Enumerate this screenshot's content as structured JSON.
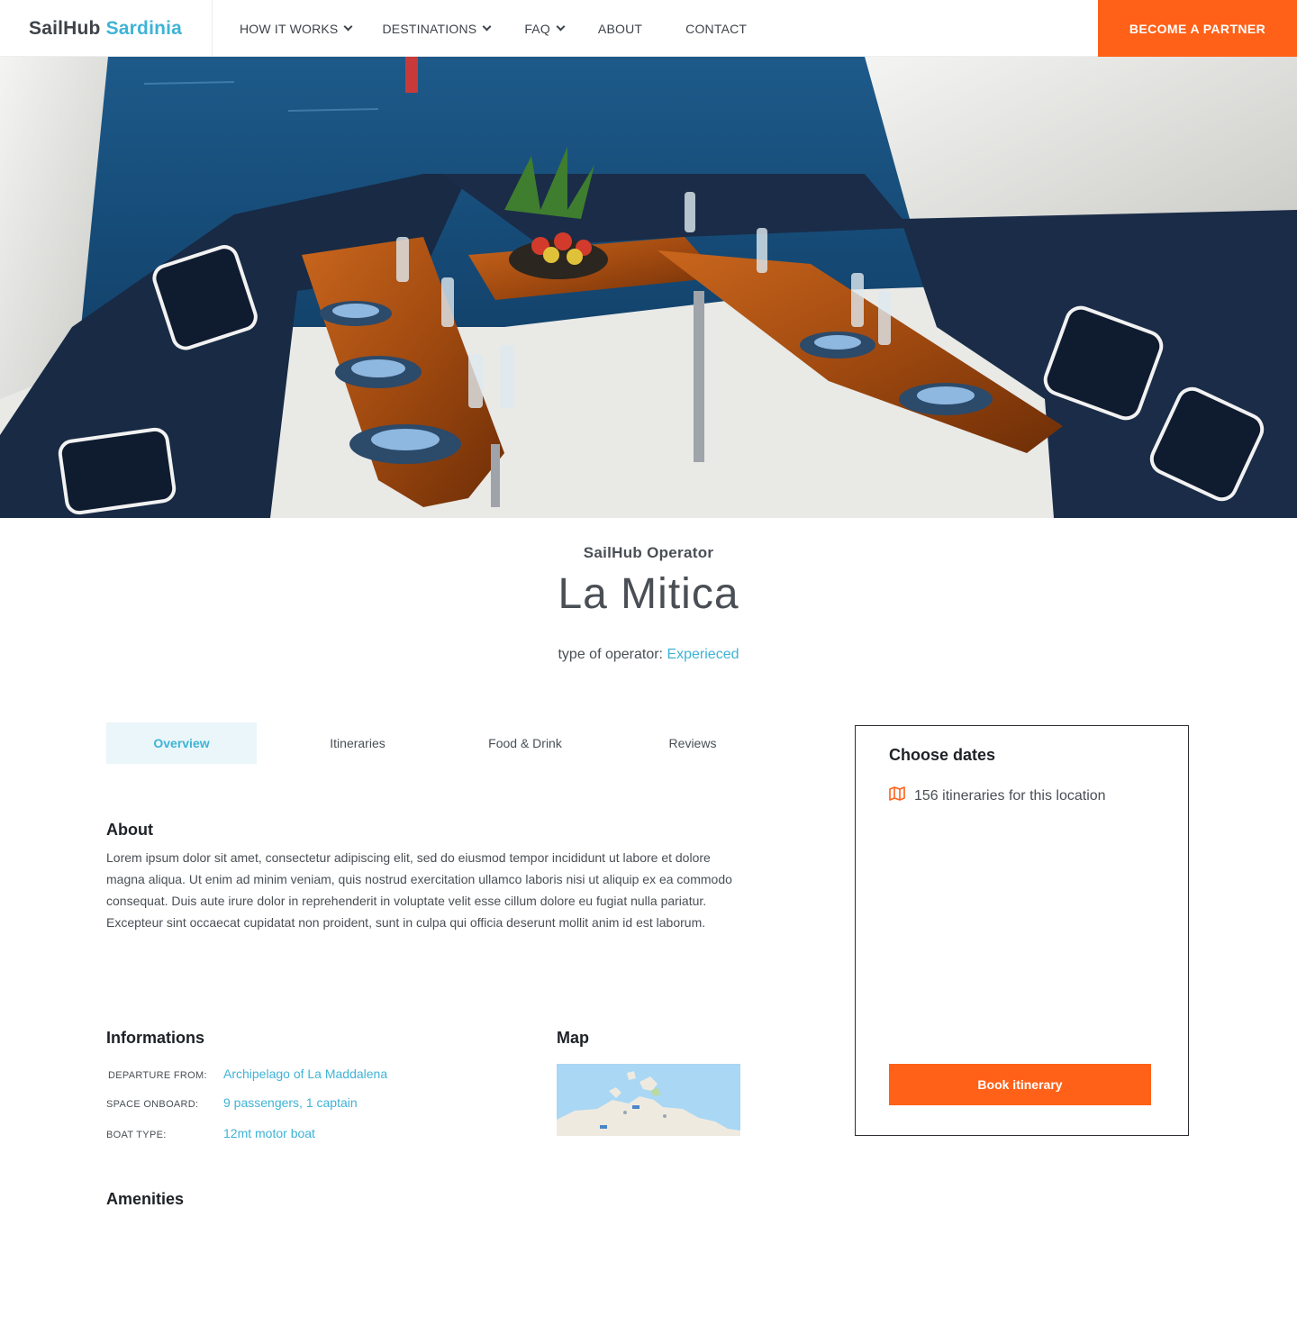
{
  "header": {
    "logo_main": "SailHub",
    "logo_accent": "Sardinia",
    "nav": [
      {
        "label": "HOW IT WORKS",
        "has_dropdown": true
      },
      {
        "label": "DESTINATIONS",
        "has_dropdown": true
      },
      {
        "label": "FAQ",
        "has_dropdown": true
      },
      {
        "label": "ABOUT",
        "has_dropdown": false
      },
      {
        "label": "CONTACT",
        "has_dropdown": false
      }
    ],
    "partner_button": "BECOME A PARTNER"
  },
  "hero": {
    "image": "yacht-cockpit-dining-table-photo"
  },
  "operator": {
    "label": "SailHub Operator",
    "name": "La Mitica",
    "type_label": "type of operator:",
    "type_value": "Experieced"
  },
  "tabs": [
    {
      "label": "Overview",
      "active": true
    },
    {
      "label": "Itineraries",
      "active": false
    },
    {
      "label": "Food & Drink",
      "active": false
    },
    {
      "label": "Reviews",
      "active": false
    }
  ],
  "about": {
    "heading": "About",
    "text": "Lorem ipsum dolor sit amet, consectetur adipiscing elit, sed do eiusmod tempor incididunt ut labore et dolore magna aliqua. Ut enim ad minim veniam, quis nostrud exercitation ullamco laboris nisi ut aliquip ex ea commodo consequat. Duis aute irure dolor in reprehenderit in voluptate velit esse cillum dolore eu fugiat nulla pariatur. Excepteur sint occaecat cupidatat non proident, sunt in culpa qui officia deserunt mollit anim id est laborum."
  },
  "informations": {
    "heading": "Informations",
    "rows": [
      {
        "key": "DEPARTURE FROM:",
        "value": "Archipelago of La Maddalena"
      },
      {
        "key": "SPACE ONBOARD:",
        "value": "9 passengers, 1 captain"
      },
      {
        "key": "BOAT TYPE:",
        "value": "12mt motor boat"
      }
    ]
  },
  "map": {
    "heading": "Map"
  },
  "amenities": {
    "heading": "Amenities"
  },
  "booking": {
    "title": "Choose dates",
    "count_text": "156 itineraries for this location",
    "button": "Book itinerary"
  },
  "colors": {
    "accent": "#3fb3d6",
    "cta": "#ff6118",
    "text": "#4a4f55",
    "tab_active_bg": "#eaf6fa"
  }
}
